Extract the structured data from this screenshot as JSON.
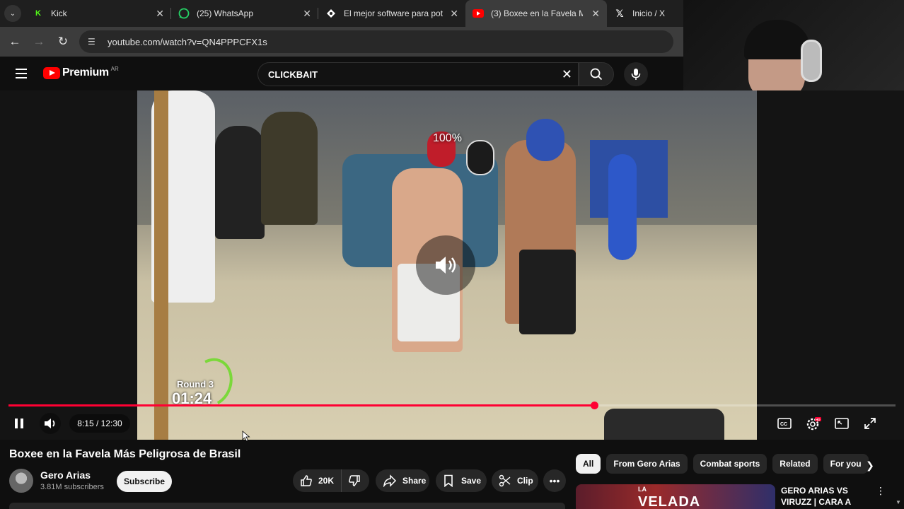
{
  "browser": {
    "tabs": [
      {
        "label": "Kick",
        "icon": "kick-icon",
        "icon_color": "#53fc18"
      },
      {
        "label": "(25) WhatsApp",
        "icon": "whatsapp-icon",
        "icon_color": "#25d366"
      },
      {
        "label": "El mejor software para pote",
        "icon": "diamond-icon",
        "icon_color": "#ffffff"
      },
      {
        "label": "(3) Boxee en la Favela M",
        "icon": "youtube-icon",
        "icon_color": "#ff0000",
        "active": true
      },
      {
        "label": "Inicio / X",
        "icon": "x-icon",
        "icon_color": "#ffffff"
      }
    ],
    "url": "youtube.com/watch?v=QN4PPPCFX1s"
  },
  "youtube": {
    "brand": "Premium",
    "country": "AR",
    "search_value": "CLICKBAIT"
  },
  "player": {
    "zoom_label": "100%",
    "round_label": "Round 3",
    "round_timer": "01:24",
    "time_display": "8:15 / 12:30",
    "progress_fraction": 0.66,
    "accent": "#ff0033"
  },
  "video": {
    "title": "Boxee en la Favela Más Peligrosa de Brasil",
    "channel": "Gero Arias",
    "subscribers": "3.81M subscribers",
    "subscribe_label": "Subscribe",
    "likes": "20K",
    "share_label": "Share",
    "save_label": "Save",
    "clip_label": "Clip"
  },
  "sidebar": {
    "chips": [
      "All",
      "From Gero Arias",
      "Combat sports",
      "Related",
      "For you"
    ],
    "recommendation": {
      "title": "GERO ARIAS VS VIRUZZ | CARA A CARA",
      "thumb_text_small": "LA",
      "thumb_text_big": "VELADA"
    }
  }
}
